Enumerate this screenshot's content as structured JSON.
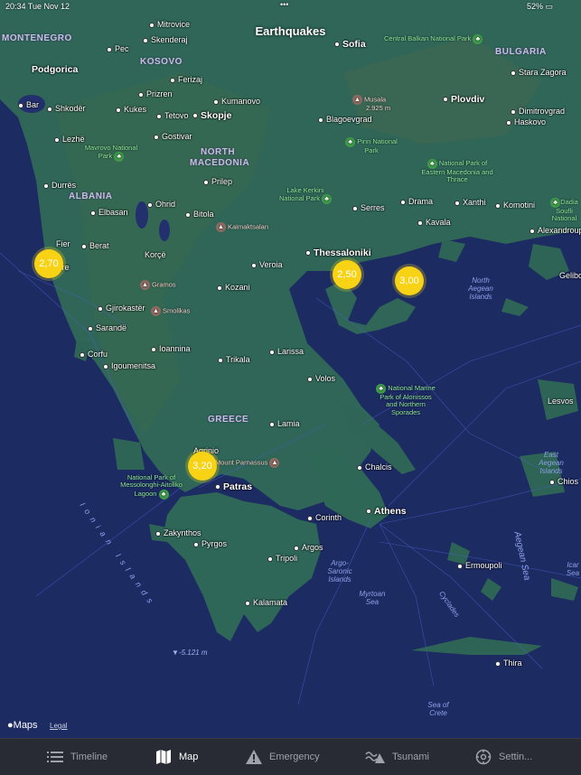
{
  "status_bar": {
    "time": "20:34",
    "date": "Tue Nov 12",
    "battery": "52%"
  },
  "map": {
    "title": "Earthquakes",
    "attribution": "Maps",
    "legal": "Legal",
    "depth_label": "▼-5.121 m",
    "countries": [
      "MONTENEGRO",
      "KOSOVO",
      "BULGARIA",
      "NORTH",
      "MACEDONIA",
      "ALBANIA",
      "GREECE"
    ],
    "cities": [
      "Podgorica",
      "Pec",
      "Mitrovice",
      "Skenderaj",
      "Prizren",
      "Ferizaj",
      "Bar",
      "Shkodër",
      "Kukes",
      "Tetovo",
      "Skopje",
      "Kumanovo",
      "Gostivar",
      "Lezhë",
      "Sofia",
      "Plovdiv",
      "Stara Zagora",
      "Dimitrovgrad",
      "Haskovo",
      "Blagoevgrad",
      "Durrës",
      "Prilep",
      "Ohrid",
      "Elbasan",
      "Bitola",
      "Serres",
      "Drama",
      "Xanthi",
      "Komotini",
      "Kavala",
      "Alexandroup",
      "Fier",
      "Berat",
      "Korçë",
      "Thessaloniki",
      "Veroia",
      "Kozani",
      "Gjirokastër",
      "Sarandë",
      "Corfu",
      "Igoumenitsa",
      "Ioannina",
      "Trikala",
      "Larissa",
      "Volos",
      "Lamia",
      "Agrinio",
      "Chalcis",
      "Patras",
      "Athens",
      "Corinth",
      "Zakynthos",
      "Pyrgos",
      "Argos",
      "Tripoli",
      "Kalamata",
      "Ermoupoli",
      "Thira",
      "Chios",
      "Lesvos",
      "Gelibo",
      "çre"
    ],
    "parks": [
      "Central Balkan National Park",
      "Mavrovo National Park",
      "Pirin National Park",
      "National Park of Eastern Macedonia and Thrace",
      "Lake Kerkini National Park",
      "Dadia Soufli National",
      "National Marine Park of Alonissos and Northern Sporades",
      "National Park of Messolonghi-Aitoliko Lagoon"
    ],
    "peaks": [
      "Musala",
      "2.925 m",
      "Kaimaktsalan",
      "Gramos",
      "Smolikas",
      "Mount Parnassus"
    ],
    "seas": [
      "North Aegean Islands",
      "Argo-Saronic Islands",
      "Myrtoan Sea",
      "Cyclades",
      "Sea of Crete",
      "East Aegean Islands",
      "Aegean Sea",
      "Ionian Islands",
      "Icar Sea"
    ],
    "quake_markers": [
      {
        "magnitude": "2,70"
      },
      {
        "magnitude": "2,50"
      },
      {
        "magnitude": "3,00"
      },
      {
        "magnitude": "3,20"
      }
    ]
  },
  "tabs": [
    {
      "label": "Timeline",
      "icon": "list-icon",
      "active": false
    },
    {
      "label": "Map",
      "icon": "map-icon",
      "active": true
    },
    {
      "label": "Emergency",
      "icon": "warning-icon",
      "active": false
    },
    {
      "label": "Tsunami",
      "icon": "tsunami-icon",
      "active": false
    },
    {
      "label": "Settin...",
      "icon": "settings-icon",
      "active": false
    }
  ],
  "colors": {
    "sea": "#1c2a5e",
    "land": "#2f6a5a",
    "marker": "#f7d215",
    "tabbar": "#282b33"
  }
}
